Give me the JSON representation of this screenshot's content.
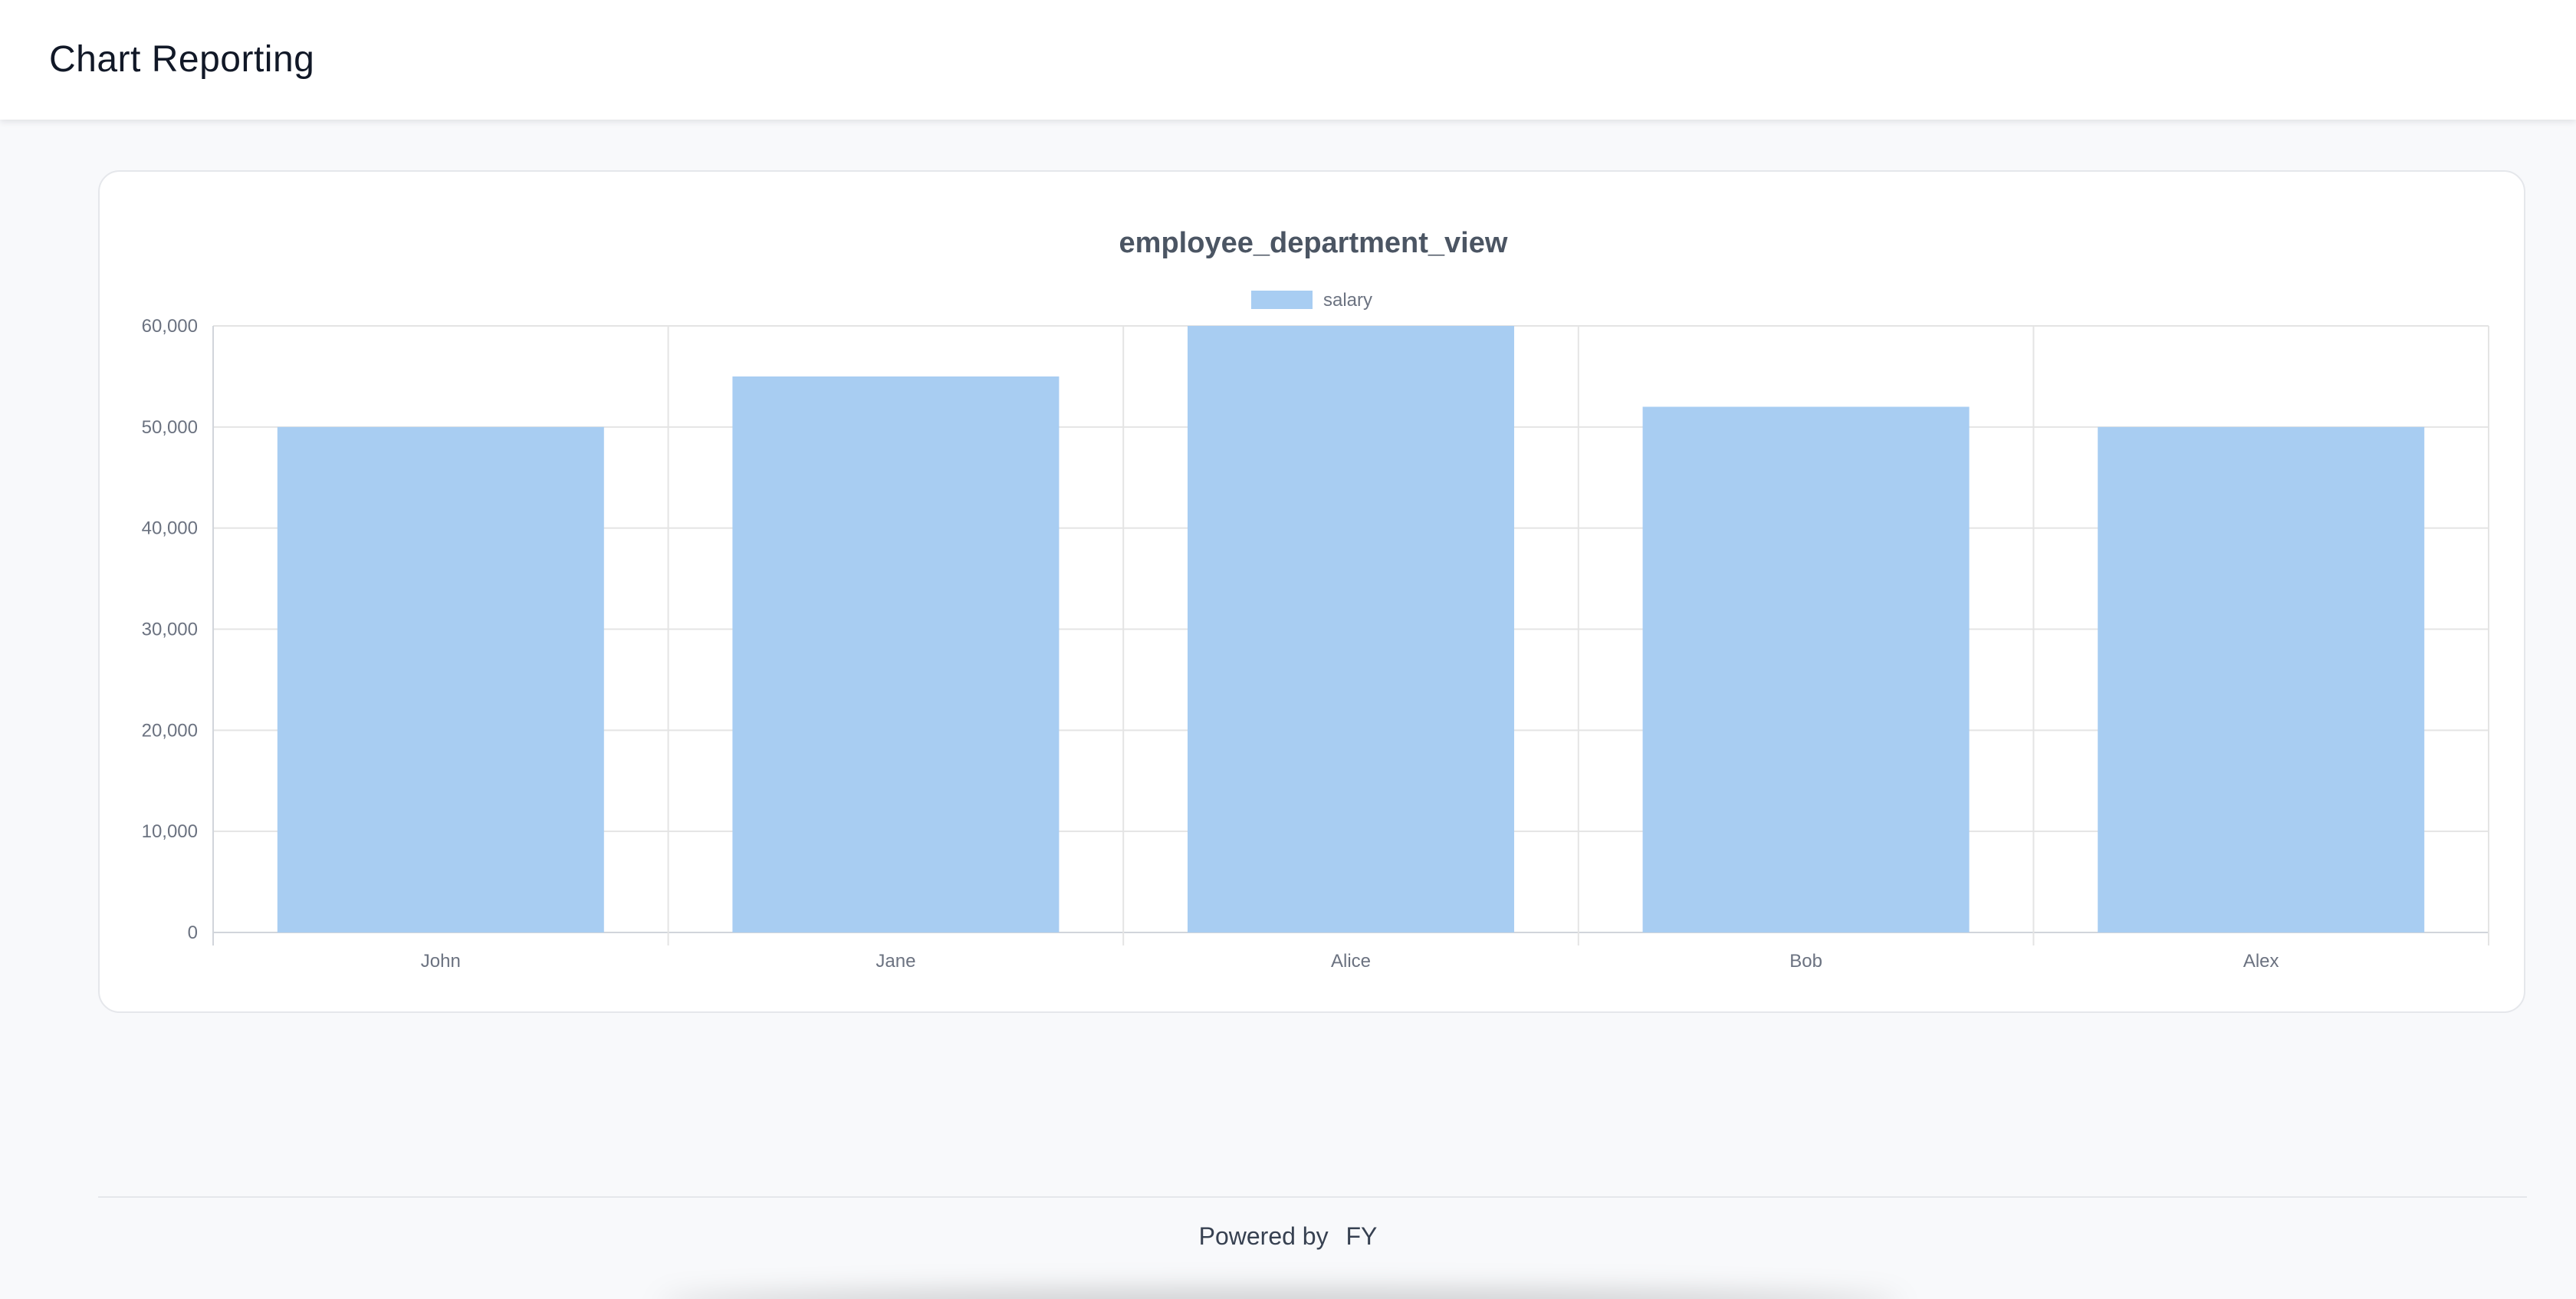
{
  "app": {
    "title": "Chart Reporting"
  },
  "footer": {
    "prefix": "Powered by",
    "brand": "FY"
  },
  "colors": {
    "bar_fill": "#a8cdf2",
    "grid": "#e4e4e4",
    "axis_text": "#6b7280",
    "title_text": "#4b5563"
  },
  "chart_data": {
    "type": "bar",
    "title": "employee_department_view",
    "categories": [
      "John",
      "Jane",
      "Alice",
      "Bob",
      "Alex"
    ],
    "series": [
      {
        "name": "salary",
        "values": [
          50000,
          55000,
          60000,
          52000,
          50000
        ]
      }
    ],
    "ylim": [
      0,
      60000
    ],
    "yticks": [
      0,
      10000,
      20000,
      30000,
      40000,
      50000,
      60000
    ],
    "ytick_labels": [
      "0",
      "10,000",
      "20,000",
      "30,000",
      "40,000",
      "50,000",
      "60,000"
    ],
    "grid": true,
    "legend": "top-center"
  }
}
